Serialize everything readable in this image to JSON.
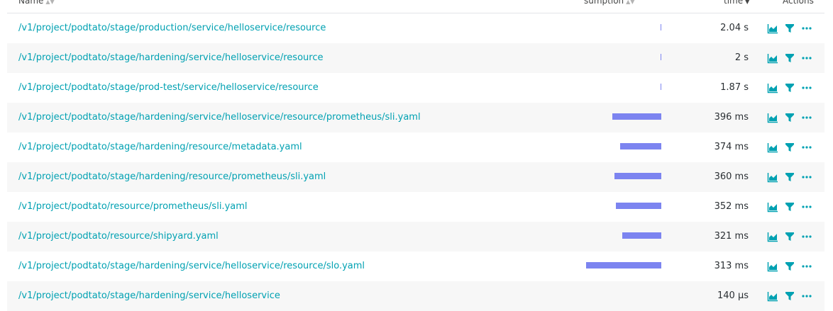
{
  "header": {
    "name": "Name",
    "consumption": "sumption",
    "time": "time",
    "actions": "Actions"
  },
  "colors": {
    "link": "#00a1b2",
    "bar": "#7c84f0",
    "icon": "#00a1b2"
  },
  "icons": [
    "chart-icon",
    "filter-icon",
    "more-icon"
  ],
  "rows": [
    {
      "name": "/v1/project/podtato/stage/production/service/helloservice/resource",
      "time": "2.04 s",
      "consumption": 0.01
    },
    {
      "name": "/v1/project/podtato/stage/hardening/service/helloservice/resource",
      "time": "2 s",
      "consumption": 0.01
    },
    {
      "name": "/v1/project/podtato/stage/prod-test/service/helloservice/resource",
      "time": "1.87 s",
      "consumption": 0.01
    },
    {
      "name": "/v1/project/podtato/stage/hardening/service/helloservice/resource/prometheus/sli.yaml",
      "time": "396 ms",
      "consumption": 0.65
    },
    {
      "name": "/v1/project/podtato/stage/hardening/resource/metadata.yaml",
      "time": "374 ms",
      "consumption": 0.55
    },
    {
      "name": "/v1/project/podtato/stage/hardening/resource/prometheus/sli.yaml",
      "time": "360 ms",
      "consumption": 0.62
    },
    {
      "name": "/v1/project/podtato/resource/prometheus/sli.yaml",
      "time": "352 ms",
      "consumption": 0.6
    },
    {
      "name": "/v1/project/podtato/resource/shipyard.yaml",
      "time": "321 ms",
      "consumption": 0.52
    },
    {
      "name": "/v1/project/podtato/stage/hardening/service/helloservice/resource/slo.yaml",
      "time": "313 ms",
      "consumption": 1.0
    },
    {
      "name": "/v1/project/podtato/stage/hardening/service/helloservice",
      "time": "140 µs",
      "consumption": 0.0
    }
  ]
}
